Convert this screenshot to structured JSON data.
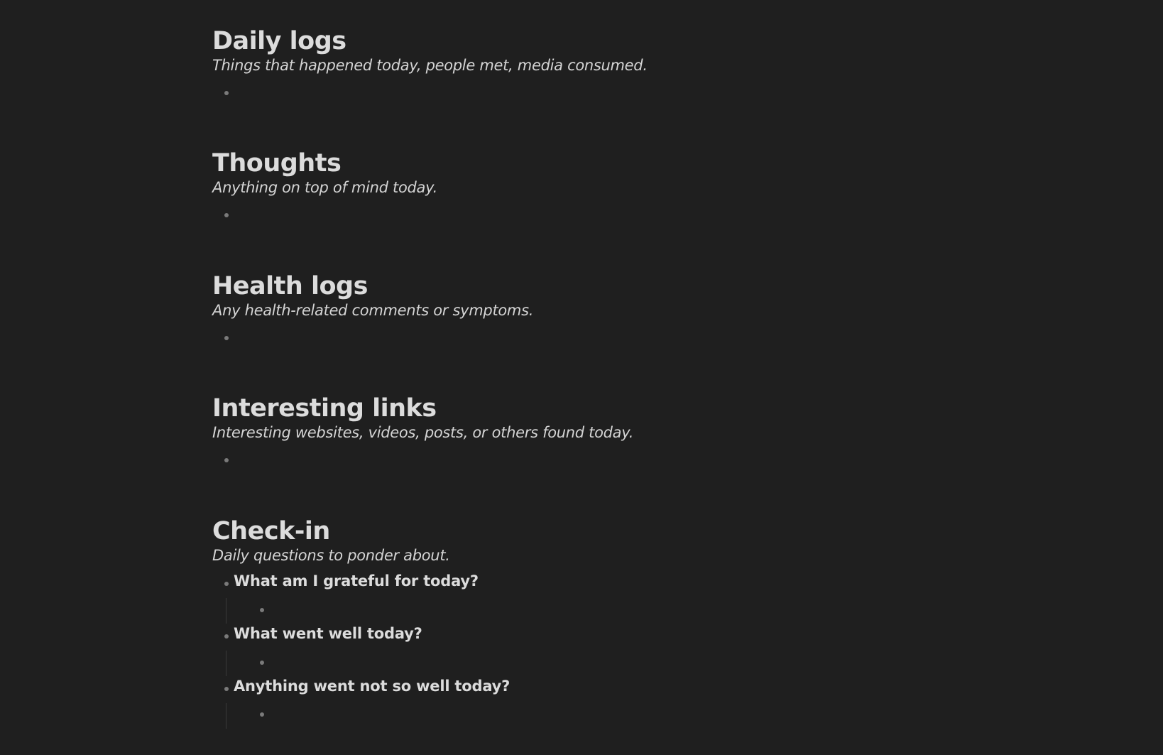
{
  "sections": [
    {
      "title": "Daily logs",
      "subtitle": "Things that happened today, people met, media consumed."
    },
    {
      "title": "Thoughts",
      "subtitle": "Anything on top of mind today."
    },
    {
      "title": "Health logs",
      "subtitle": "Any health-related comments or symptoms."
    },
    {
      "title": "Interesting links",
      "subtitle": "Interesting websites, videos, posts, or others found today."
    },
    {
      "title": "Check-in",
      "subtitle": "Daily questions to ponder about.",
      "questions": [
        "What am I grateful for today?",
        "What went well today?",
        "Anything went not so well today?"
      ]
    }
  ],
  "colors": {
    "background": "#1f1f1f",
    "text": "#dcdcdc",
    "bullet": "#7a7a7a",
    "guide_line": "#3a3a3a"
  }
}
